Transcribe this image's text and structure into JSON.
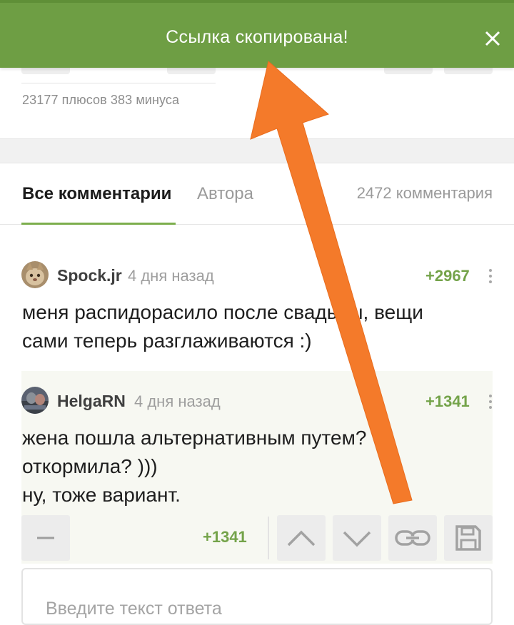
{
  "toast": {
    "message": "Ссылка скопирована!"
  },
  "post_stats": {
    "rating_text": "23177 плюсов 383 минуса"
  },
  "tabs": {
    "all_label": "Все комментарии",
    "author_label": "Автора",
    "comments_count": "2472 комментария"
  },
  "comments": [
    {
      "username": "Spock.jr",
      "time": "4 дня назад",
      "score": "+2967",
      "lines": [
        "меня распидорасило после свадьбы, вещи",
        "сами теперь разглаживаются :)"
      ]
    },
    {
      "username": "HelgaRN",
      "time": "4 дня назад",
      "score": "+1341",
      "lines": [
        "жена пошла альтернативным путем?",
        "откормила? )))",
        "ну, тоже вариант."
      ]
    }
  ],
  "actions": {
    "score": "+1341"
  },
  "reply": {
    "placeholder": "Введите текст ответа"
  },
  "colors": {
    "toast_bg": "#6e9e44",
    "score_green": "#74a34a",
    "tab_underline": "#7cae4d",
    "annotation_arrow": "#f47a2a"
  },
  "icons": [
    "close-icon",
    "more-vertical-icon",
    "minus-icon",
    "chevron-up-icon",
    "chevron-down-icon",
    "link-icon",
    "save-icon"
  ]
}
